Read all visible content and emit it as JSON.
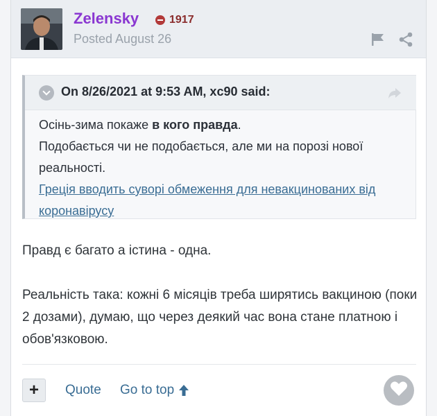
{
  "author": {
    "name": "Zelensky",
    "reputation": "1917",
    "posted": "Posted August 26"
  },
  "quote": {
    "citation": "On 8/26/2021 at 9:53 AM, xc90 said:",
    "line1_prefix": "Осінь-зима покаже ",
    "line1_bold": "в кого правда",
    "line1_suffix": ".",
    "line2": "Подобається чи не подобається, але ми на порозі нової реальності.",
    "link_text": "Греція вводить суворі обмеження для невакцинованих від коронавірусу"
  },
  "content": {
    "paragraph1": "Правд є багато а істина - одна.",
    "paragraph2": "Реальність така: кожні 6 місяців треба ширятись вакциною (поки 2 дозами), думаю, що через деякий час вона стане платною і обов'язковою."
  },
  "actions": {
    "plus_label": "+",
    "quote_label": "Quote",
    "go_top_label": "Go to top"
  },
  "colors": {
    "author": "#8a37d1",
    "link": "#3a6d94",
    "reputation_badge": "#b23a3a"
  },
  "icons": [
    "rep-minus-icon",
    "flag-icon",
    "share-icon",
    "chevron-down-icon",
    "reply-arrow-icon",
    "arrow-up-icon",
    "heart-icon"
  ]
}
